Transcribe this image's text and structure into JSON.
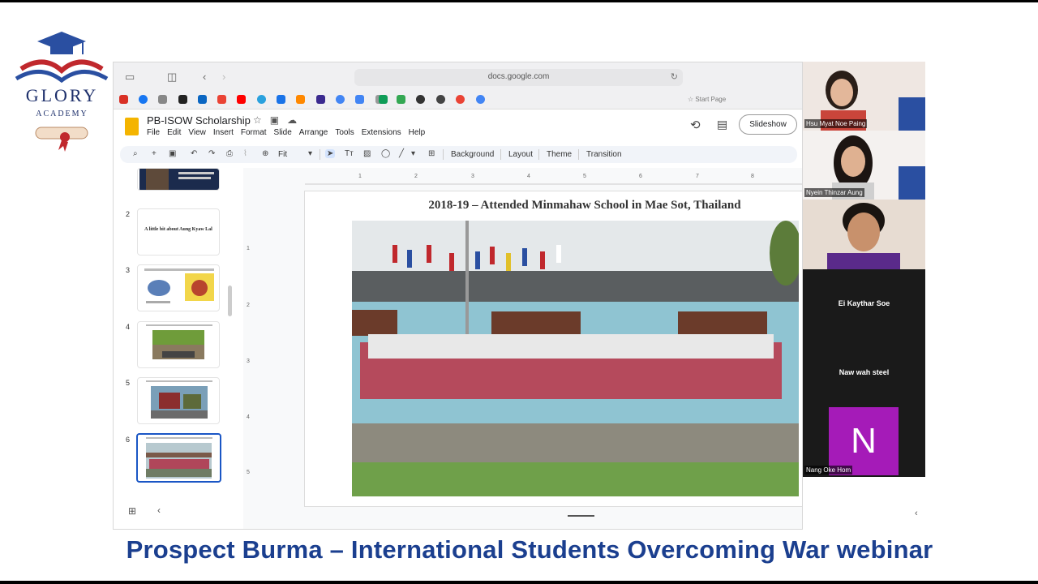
{
  "logo": {
    "line1": "GLORY",
    "line2": "ACADEMY"
  },
  "browser": {
    "url": "docs.google.com",
    "start_page": "Start Page",
    "reload_icon": "reload-icon"
  },
  "docs": {
    "title": "PB-ISOW Scholarship",
    "menu": [
      "File",
      "Edit",
      "View",
      "Insert",
      "Format",
      "Slide",
      "Arrange",
      "Tools",
      "Extensions",
      "Help"
    ],
    "slideshow_label": "Slideshow",
    "toolbar": {
      "zoom": "Fit",
      "background": "Background",
      "layout": "Layout",
      "theme": "Theme",
      "transition": "Transition"
    }
  },
  "filmstrip": {
    "slides": [
      {
        "num": "2",
        "text": "A little bit about Aung Kyaw Lal"
      },
      {
        "num": "3",
        "text": ""
      },
      {
        "num": "4",
        "text": ""
      },
      {
        "num": "5",
        "text": ""
      },
      {
        "num": "6",
        "text": ""
      }
    ]
  },
  "ruler": {
    "h": [
      "1",
      "2",
      "3",
      "4",
      "5",
      "6",
      "7",
      "8"
    ],
    "v": [
      "1",
      "2",
      "3",
      "4",
      "5"
    ]
  },
  "slide": {
    "title": "2018-19 – Attended Minmahaw School in Mae Sot, Thailand"
  },
  "participants": [
    {
      "name": "Hsu Myat Noe Paing"
    },
    {
      "name": "Nyein Thinzar Aung"
    },
    {
      "name": ""
    },
    {
      "name": "Ei Kaythar Soe"
    },
    {
      "name": "Naw wah steel"
    },
    {
      "name": "Nang Oke Hom",
      "initial": "N"
    }
  ],
  "caption": "Prospect Burma – International Students Overcoming War webinar",
  "colors": {
    "accent": "#1b3f8f",
    "docs_yellow": "#f4b400",
    "avatar": "#a51bb8"
  }
}
